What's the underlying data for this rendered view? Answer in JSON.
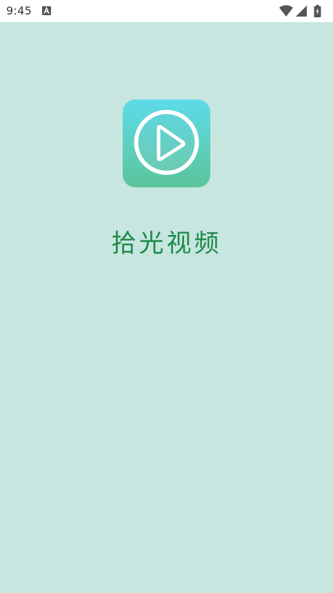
{
  "status_bar": {
    "time": "9:45",
    "icons": [
      "notification-a-icon",
      "wifi-icon",
      "signal-icon",
      "battery-icon"
    ]
  },
  "splash": {
    "logo_icon": "play-icon",
    "app_name": "拾光视频"
  },
  "colors": {
    "background": "#c6e6df",
    "app_name": "#1f8a4a",
    "logo_gradient_top": "#5ddbe9",
    "logo_gradient_bottom": "#5bc59a"
  }
}
